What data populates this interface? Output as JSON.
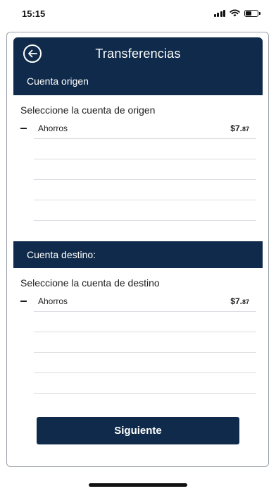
{
  "status_bar": {
    "time": "15:15",
    "battery_level": 0.45
  },
  "header": {
    "title": "Transferencias",
    "back_icon": "back-arrow-circle-icon"
  },
  "origen": {
    "section_title": "Cuenta origen",
    "select_label": "Seleccione la cuenta de origen",
    "accounts": [
      {
        "name": "Ahorros",
        "amount_main": "$7.",
        "amount_cents": "87"
      }
    ]
  },
  "destino": {
    "section_title": "Cuenta destino:",
    "select_label": "Seleccione la cuenta de destino",
    "accounts": [
      {
        "name": "Ahorros",
        "amount_main": "$7.",
        "amount_cents": "87"
      }
    ]
  },
  "footer": {
    "next_label": "Siguiente"
  },
  "colors": {
    "primary": "#0f2a4a",
    "divider": "#dadde1",
    "frame_border": "#9aa0a8"
  }
}
